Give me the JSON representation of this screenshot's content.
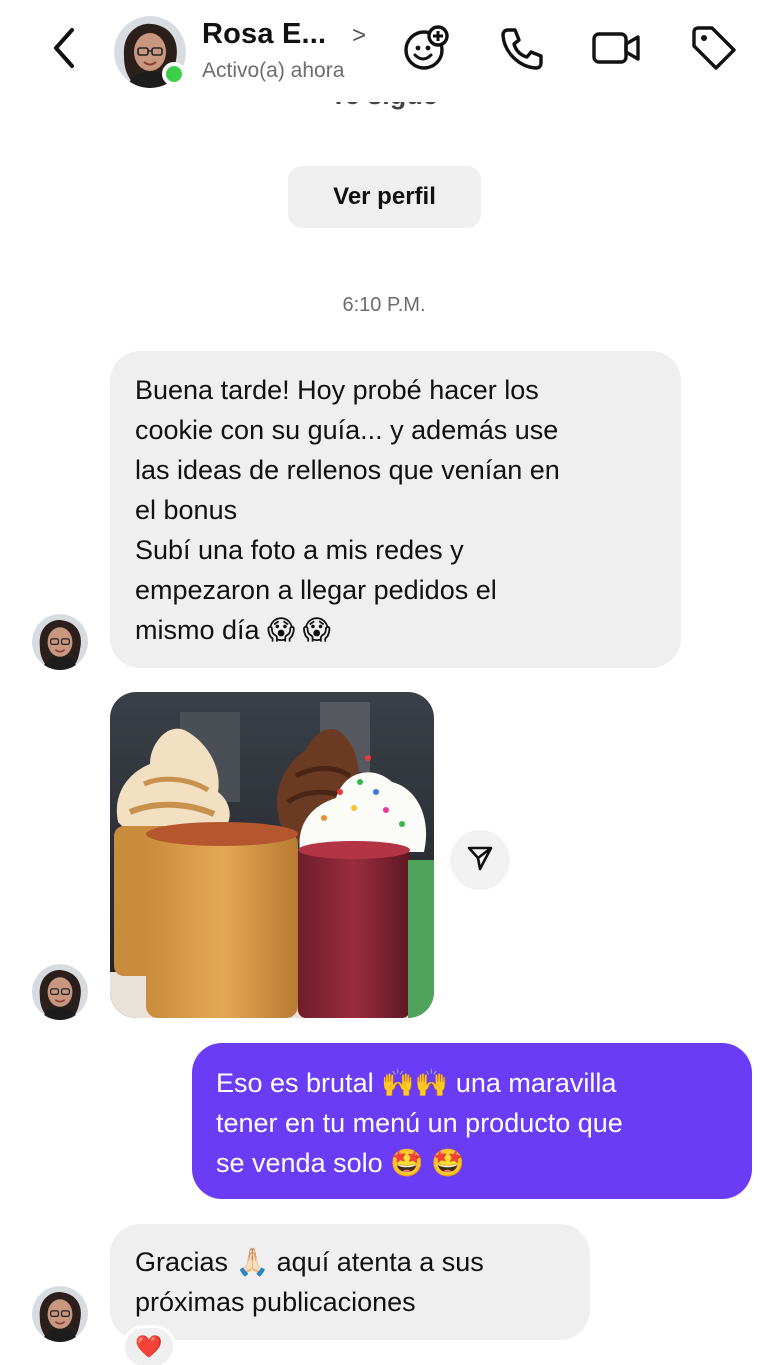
{
  "header": {
    "contact_name": "Rosa E...",
    "name_chevron": ">",
    "status": "Activo(a) ahora",
    "icons": [
      "chevron-left-icon",
      "effects-icon",
      "phone-icon",
      "video-icon",
      "tag-icon"
    ],
    "online_color": "#3ecf4a"
  },
  "conversation": {
    "follows_label": "Te sigue",
    "view_profile_label": "Ver perfil",
    "timestamp": "6:10 P.M."
  },
  "messages": [
    {
      "sender": "contact",
      "lines": [
        "Buena tarde! Hoy probé hacer los",
        "cookie con su guía... y además use",
        "las ideas de rellenos que venían en",
        "el bonus",
        "Subí una foto a mis redes y",
        "empezaron a llegar pedidos el",
        "mismo día 😱 😱"
      ]
    },
    {
      "sender": "contact",
      "type": "photo",
      "description_icon": "share-icon"
    },
    {
      "sender": "me",
      "lines": [
        "Eso es brutal 🙌🙌 una maravilla",
        "tener en tu menú un producto que",
        "se venda solo 🤩 🤩"
      ]
    },
    {
      "sender": "contact",
      "lines": [
        "Gracias 🙏🏻 aquí atenta a sus",
        "próximas publicaciones"
      ],
      "reaction": "❤️"
    }
  ],
  "colors": {
    "outgoing_bubble": "#6b3cf6",
    "incoming_bubble": "#efefef"
  }
}
